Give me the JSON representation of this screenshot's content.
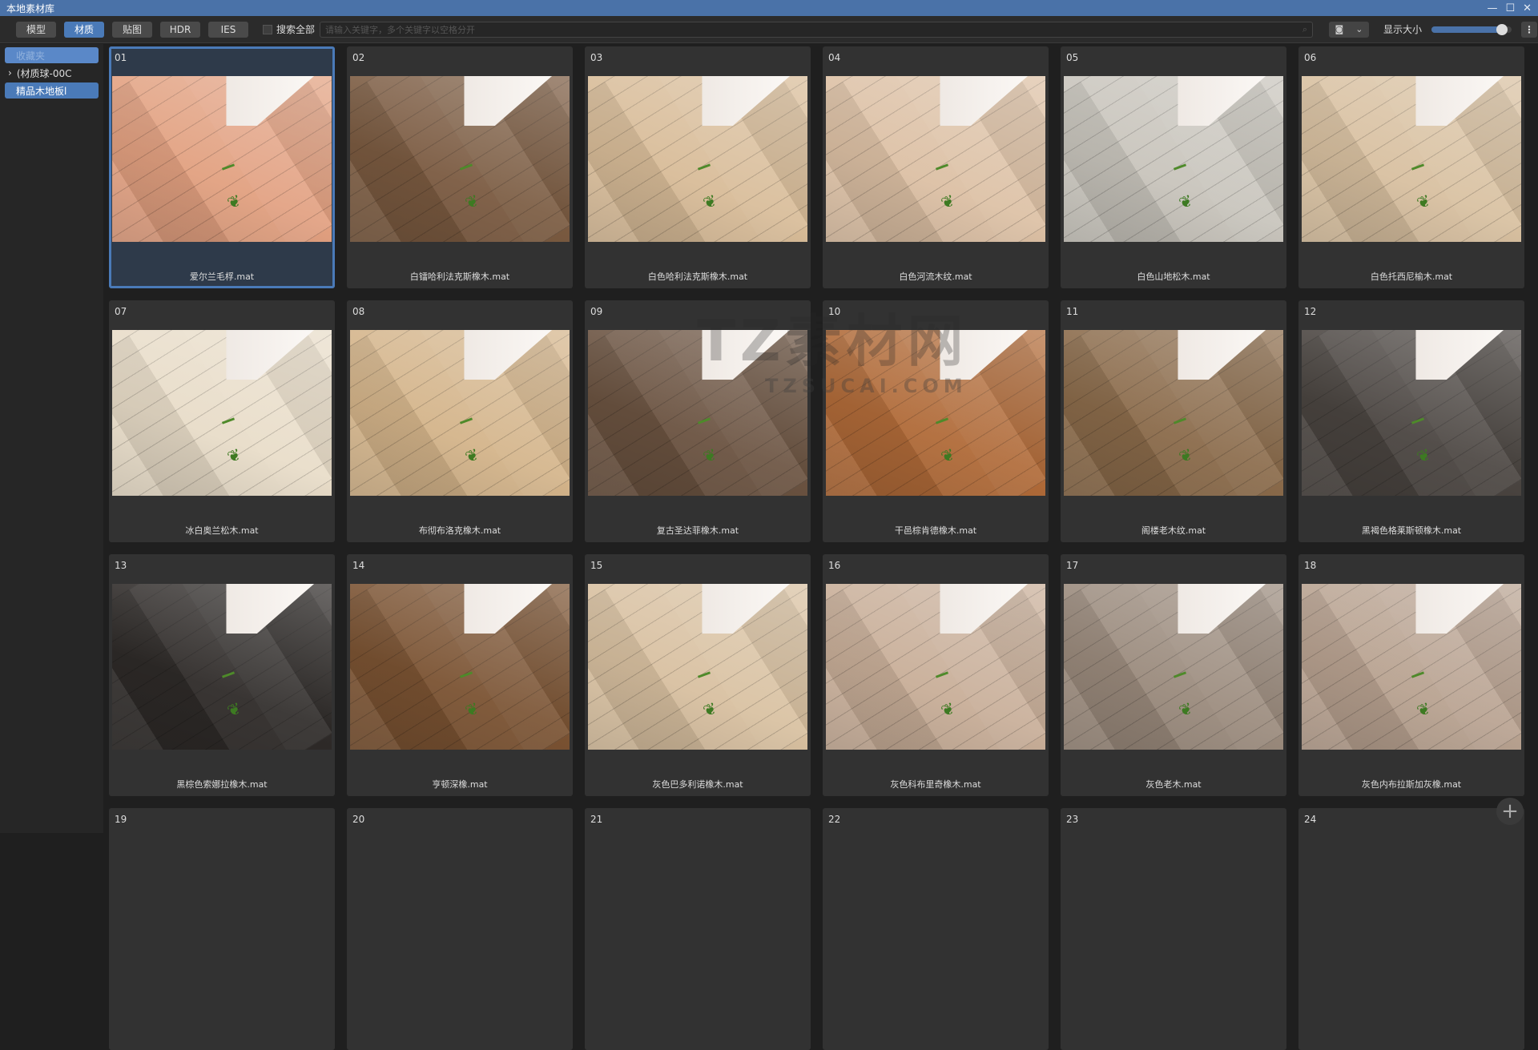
{
  "window": {
    "title": "本地素材库",
    "controls": [
      "—",
      "☐",
      "✕"
    ]
  },
  "toolbar": {
    "tabs": [
      {
        "label": "模型",
        "active": false
      },
      {
        "label": "材质",
        "active": true
      },
      {
        "label": "贴图",
        "active": false
      },
      {
        "label": "HDR",
        "active": false
      },
      {
        "label": "IES",
        "active": false
      }
    ],
    "search_all_label": "搜索全部",
    "search_all_checked": false,
    "search_placeholder": "请输入关键字，多个关键字以空格分开",
    "search_icon": "⌕",
    "camera_icon": "◙",
    "chevron_icon": "⌄",
    "display_size_label": "显示大小",
    "display_size_percent": 88,
    "more_icon": "⋮"
  },
  "sidebar": {
    "favorites": "收藏夹",
    "tree_item": "(材质球-00C",
    "tree_arrow": "›",
    "selected_item": "精品木地板l"
  },
  "watermark": {
    "logo": "TZ素材网",
    "url": "TZSUCAI.COM"
  },
  "items": [
    {
      "num": "01",
      "name": "爱尔兰毛桴.mat",
      "color": "#e2a080",
      "selected": true
    },
    {
      "num": "02",
      "name": "白镭哈利法克斯橡木.mat",
      "color": "#7a5a40"
    },
    {
      "num": "03",
      "name": "白色哈利法克斯橡木.mat",
      "color": "#d8bc98"
    },
    {
      "num": "04",
      "name": "白色河流木纹.mat",
      "color": "#dcc0a4"
    },
    {
      "num": "05",
      "name": "白色山地松木.mat",
      "color": "#c8c4bc"
    },
    {
      "num": "06",
      "name": "白色托西尼榆木.mat",
      "color": "#d8c0a0"
    },
    {
      "num": "07",
      "name": "冰白奥兰松木.mat",
      "color": "#e8dcc8"
    },
    {
      "num": "08",
      "name": "布彻布洛克橡木.mat",
      "color": "#d4b48a"
    },
    {
      "num": "09",
      "name": "复古圣达菲橡木.mat",
      "color": "#6a5240"
    },
    {
      "num": "10",
      "name": "干邑棕肯德橡木.mat",
      "color": "#b06a38"
    },
    {
      "num": "11",
      "name": "阁楼老木纹.mat",
      "color": "#8a6a4a"
    },
    {
      "num": "12",
      "name": "黑褐色格莱斯顿橡木.mat",
      "color": "#4a4440"
    },
    {
      "num": "13",
      "name": "黑棕色索娜拉橡木.mat",
      "color": "#2e2a28"
    },
    {
      "num": "14",
      "name": "亨顿深橡.mat",
      "color": "#7a5232"
    },
    {
      "num": "15",
      "name": "灰色巴多利诺橡木.mat",
      "color": "#d8c0a0"
    },
    {
      "num": "16",
      "name": "灰色科布里奇橡木.mat",
      "color": "#c8ae98"
    },
    {
      "num": "17",
      "name": "灰色老木.mat",
      "color": "#9a8a7c"
    },
    {
      "num": "18",
      "name": "灰色内布拉斯加灰橡.mat",
      "color": "#b8a290"
    },
    {
      "num": "19",
      "name": "",
      "color": ""
    },
    {
      "num": "20",
      "name": "",
      "color": ""
    },
    {
      "num": "21",
      "name": "",
      "color": ""
    },
    {
      "num": "22",
      "name": "",
      "color": ""
    },
    {
      "num": "23",
      "name": "",
      "color": ""
    },
    {
      "num": "24",
      "name": "",
      "color": ""
    }
  ],
  "add_icon": "+"
}
